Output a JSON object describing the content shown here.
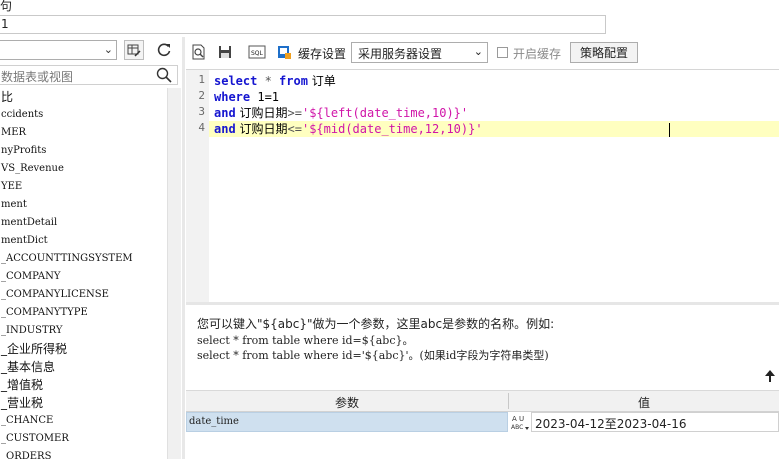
{
  "top": {
    "label": "句",
    "name_value": "1"
  },
  "left_panel": {
    "search_placeholder": "数据表或视图",
    "tables": [
      "比",
      "ccidents",
      "MER",
      "nyProfits",
      "VS_Revenue",
      "YEE",
      "ment",
      "mentDetail",
      "mentDict",
      "_ACCOUNTTINGSYSTEM",
      "_COMPANY",
      "_COMPANYLICENSE",
      "_COMPANYTYPE",
      "_INDUSTRY",
      "_企业所得税",
      "_基本信息",
      "_增值税",
      "_营业税",
      "_CHANCE",
      "_CUSTOMER",
      "_ORDERS"
    ]
  },
  "toolbar": {
    "icons": [
      "preview-icon",
      "save-icon",
      "sql-icon",
      "bookmark-icon"
    ],
    "cache_label": "缓存设置",
    "cache_option": "采用服务器设置",
    "enable_cache_label": "开启缓存",
    "strategy_button": "策略配置"
  },
  "editor": {
    "line_numbers": [
      "1",
      "2",
      "3",
      "4"
    ],
    "lines": [
      [
        {
          "t": "kw",
          "v": "select"
        },
        {
          "t": "op",
          "v": " * "
        },
        {
          "t": "kw",
          "v": "from"
        },
        {
          "t": "cjkc",
          "v": " 订单"
        }
      ],
      [
        {
          "t": "kw",
          "v": "where"
        },
        {
          "t": "plain",
          "v": " 1=1"
        }
      ],
      [
        {
          "t": "kw",
          "v": "and"
        },
        {
          "t": "cjkc",
          "v": " 订购日期"
        },
        {
          "t": "op",
          "v": ">="
        },
        {
          "t": "str",
          "v": "'${left(date_time,10)}'"
        }
      ],
      [
        {
          "t": "kw",
          "v": "and"
        },
        {
          "t": "cjkc",
          "v": " 订购日期"
        },
        {
          "t": "op",
          "v": "<="
        },
        {
          "t": "str",
          "v": "'${mid(date_time,12,10)}'"
        }
      ]
    ]
  },
  "hint": {
    "line1": "您可以键入\"${abc}\"做为一个参数，这里abc是参数的名称。例如:",
    "line2": "select * from table where id=${abc}。",
    "line3": "select * from table where id='${abc}'。(如果id字段为字符串类型)"
  },
  "params": {
    "header_param": "参数",
    "header_value": "值",
    "rows": [
      {
        "name": "date_time",
        "type_icon": "text-type-icon",
        "value": "2023-04-12至2023-04-16"
      }
    ]
  }
}
